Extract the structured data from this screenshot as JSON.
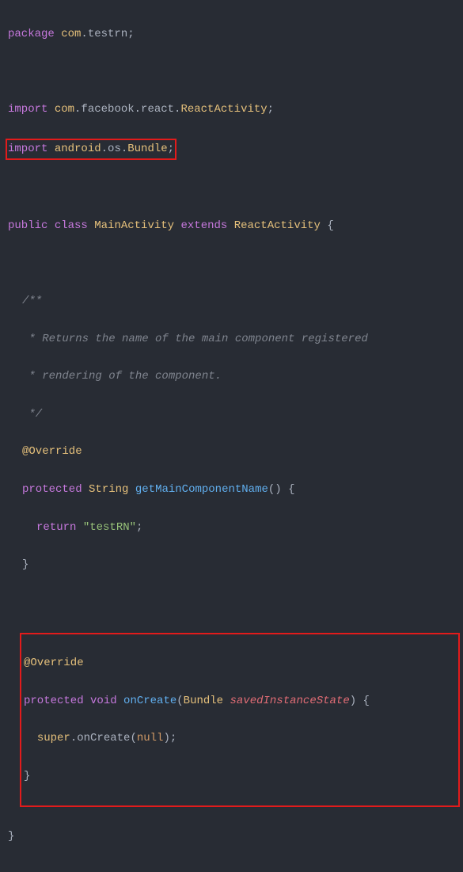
{
  "code": {
    "pkg_kw": "package",
    "pkg_path_a": " com",
    "pkg_path_b": ".testrn",
    "semi": ";",
    "import_kw": "import",
    "imp1_a": " com",
    "imp1_b": ".facebook.react.",
    "imp1_c": "ReactActivity",
    "imp2_a": " android",
    "imp2_b": ".os.",
    "imp2_c": "Bundle",
    "public_kw": "public",
    "class_kw": "class",
    "main_cls": "MainActivity",
    "extends_kw": "extends",
    "react_cls": "ReactActivity",
    "brace_o": "{",
    "brace_c": "}",
    "c1": "/**",
    "c2": " * Returns the name of the main component registered",
    "c3": " * rendering of the component.",
    "c4": " */",
    "override": "@Override",
    "protected_kw": "protected",
    "ret_type": "String",
    "fn1": "getMainComponentName",
    "paren": "()",
    "return_kw": "return",
    "strlit": "\"testRN\"",
    "void_kw": "void",
    "fn2": "onCreate",
    "p_type": "Bundle",
    "p_name": "savedInstanceState",
    "super_call_a": "super",
    "super_call_b": ".onCreate(",
    "null_kw": "null",
    "close_paren": ")"
  }
}
